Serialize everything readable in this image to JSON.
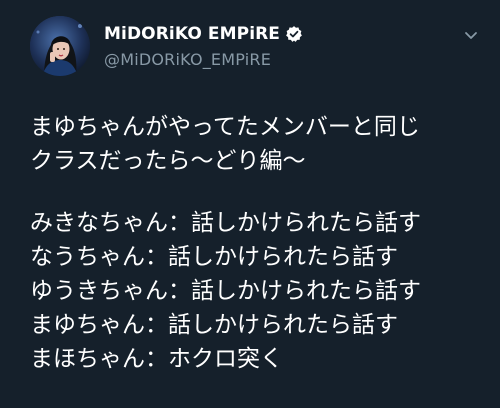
{
  "author": {
    "display_name": "MiDORiKO EMPiRE",
    "handle": "@MiDORiKO_EMPiRE",
    "verified": true
  },
  "tweet": {
    "intro_lines": [
      "まゆちゃんがやってたメンバーと同じ",
      "クラスだったら〜どり編〜"
    ],
    "list_lines": [
      "みきなちゃん：話しかけられたら話す",
      "なうちゃん：話しかけられたら話す",
      "ゆうきちゃん：話しかけられたら話す",
      "まゆちゃん：話しかけられたら話す",
      "まほちゃん：ホクロ突く"
    ]
  },
  "icons": {
    "verified": "verified-badge-icon",
    "menu": "chevron-down-icon"
  },
  "colors": {
    "background": "#15202b",
    "text_primary": "#ffffff",
    "text_secondary": "#8899a6"
  }
}
